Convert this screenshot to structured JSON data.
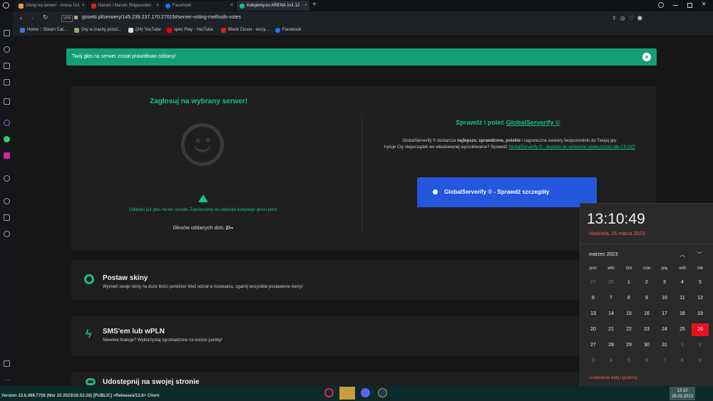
{
  "browser": {
    "tabs": [
      {
        "label": "Głosy na serwer - Arena 1v1"
      },
      {
        "label": "Naruto i Naruto Shippuuden"
      },
      {
        "label": "Facebook"
      },
      {
        "label": "Katujemy.eu ARENA 1v1 12"
      }
    ],
    "url": "gosetti.pl/serwery/145.239.237.170:27015#server-voting-methods-votes",
    "vpn_label": "VPN",
    "bookmarks": [
      {
        "label": "Home :: Steam Car..."
      },
      {
        "label": "Gry w zrachy przez..."
      },
      {
        "label": "(24) YouTube"
      },
      {
        "label": "spec Play - YouTube"
      },
      {
        "label": "Black Clover - wszy..."
      },
      {
        "label": "Facebook"
      }
    ]
  },
  "alert": {
    "message": "Twój głos na serwer został prawidłowo oddany!",
    "close_label": "×"
  },
  "vote": {
    "title": "Zagłosuj na wybrany serwer!",
    "warning_text": "Oddałeś już głos na ten serwer. Zapraszamy do oddania kolejnego głosu jutro!",
    "count_label": "Głosów oddanych dziś:",
    "count_value": "2/∞"
  },
  "promo": {
    "title_prefix": "Sprawdź i poleć",
    "title_link": "GlobalServerify ©",
    "text1_a": "GlobalServerify © dostarcza ",
    "text1_b": "najlepsze, sprawdzone, polskie",
    "text1_c": " i zagraniczne serwery bezpośrednio do Twojej gry.",
    "text2": "Irytuje Cię nieporządek we wbudowanej wyszukiwarce? Sprawdź",
    "text2_link": "GlobalServerify © - dodatek do serwerów społeczności dla CS:GO!",
    "button_label": "GlobalServerify © - Sprawdź szczegóły"
  },
  "methods": [
    {
      "title": "Postaw skiny",
      "desc": "Wymień swoje skiny na duże ilości punktów! Weź udział w losowaniu, zgarnij wszystkie postawione itemy!"
    },
    {
      "title": "SMS'em lub wPLN",
      "desc": "Niewiele brakuje? Wykorzystaj zgromadzone na koncie punkty!"
    },
    {
      "title": "Udostepnij na swojej stronie",
      "desc": ""
    }
  ],
  "calendar": {
    "time": "13:10:49",
    "date": "niedziela, 26 marca 2023",
    "month": "marzec 2023",
    "weekdays": [
      "pon",
      "wto",
      "śro",
      "czw",
      "pią",
      "sob",
      "nie"
    ],
    "weeks": [
      [
        "27",
        "28",
        "1",
        "2",
        "3",
        "4",
        "5"
      ],
      [
        "6",
        "7",
        "8",
        "9",
        "10",
        "11",
        "12"
      ],
      [
        "13",
        "14",
        "15",
        "16",
        "17",
        "18",
        "19"
      ],
      [
        "20",
        "21",
        "22",
        "23",
        "24",
        "25",
        "26"
      ],
      [
        "27",
        "28",
        "29",
        "30",
        "31",
        "1",
        "2"
      ],
      [
        "3",
        "4",
        "5",
        "6",
        "7",
        "8",
        "9"
      ]
    ],
    "today": "26",
    "settings_label": "Ustawienia daty i godziny"
  },
  "taskbar": {
    "status": "Version 13.6.499.7758 (Mar 23 2023/18:53:26) [PUBLIC] <Releases/13.6> Client",
    "clock_time": "13:10",
    "clock_date": "26.03.2023"
  },
  "colors": {
    "accent_green": "#17c28a",
    "alert_green": "#139f73",
    "button_blue": "#2456de",
    "today_red": "#e81123"
  }
}
